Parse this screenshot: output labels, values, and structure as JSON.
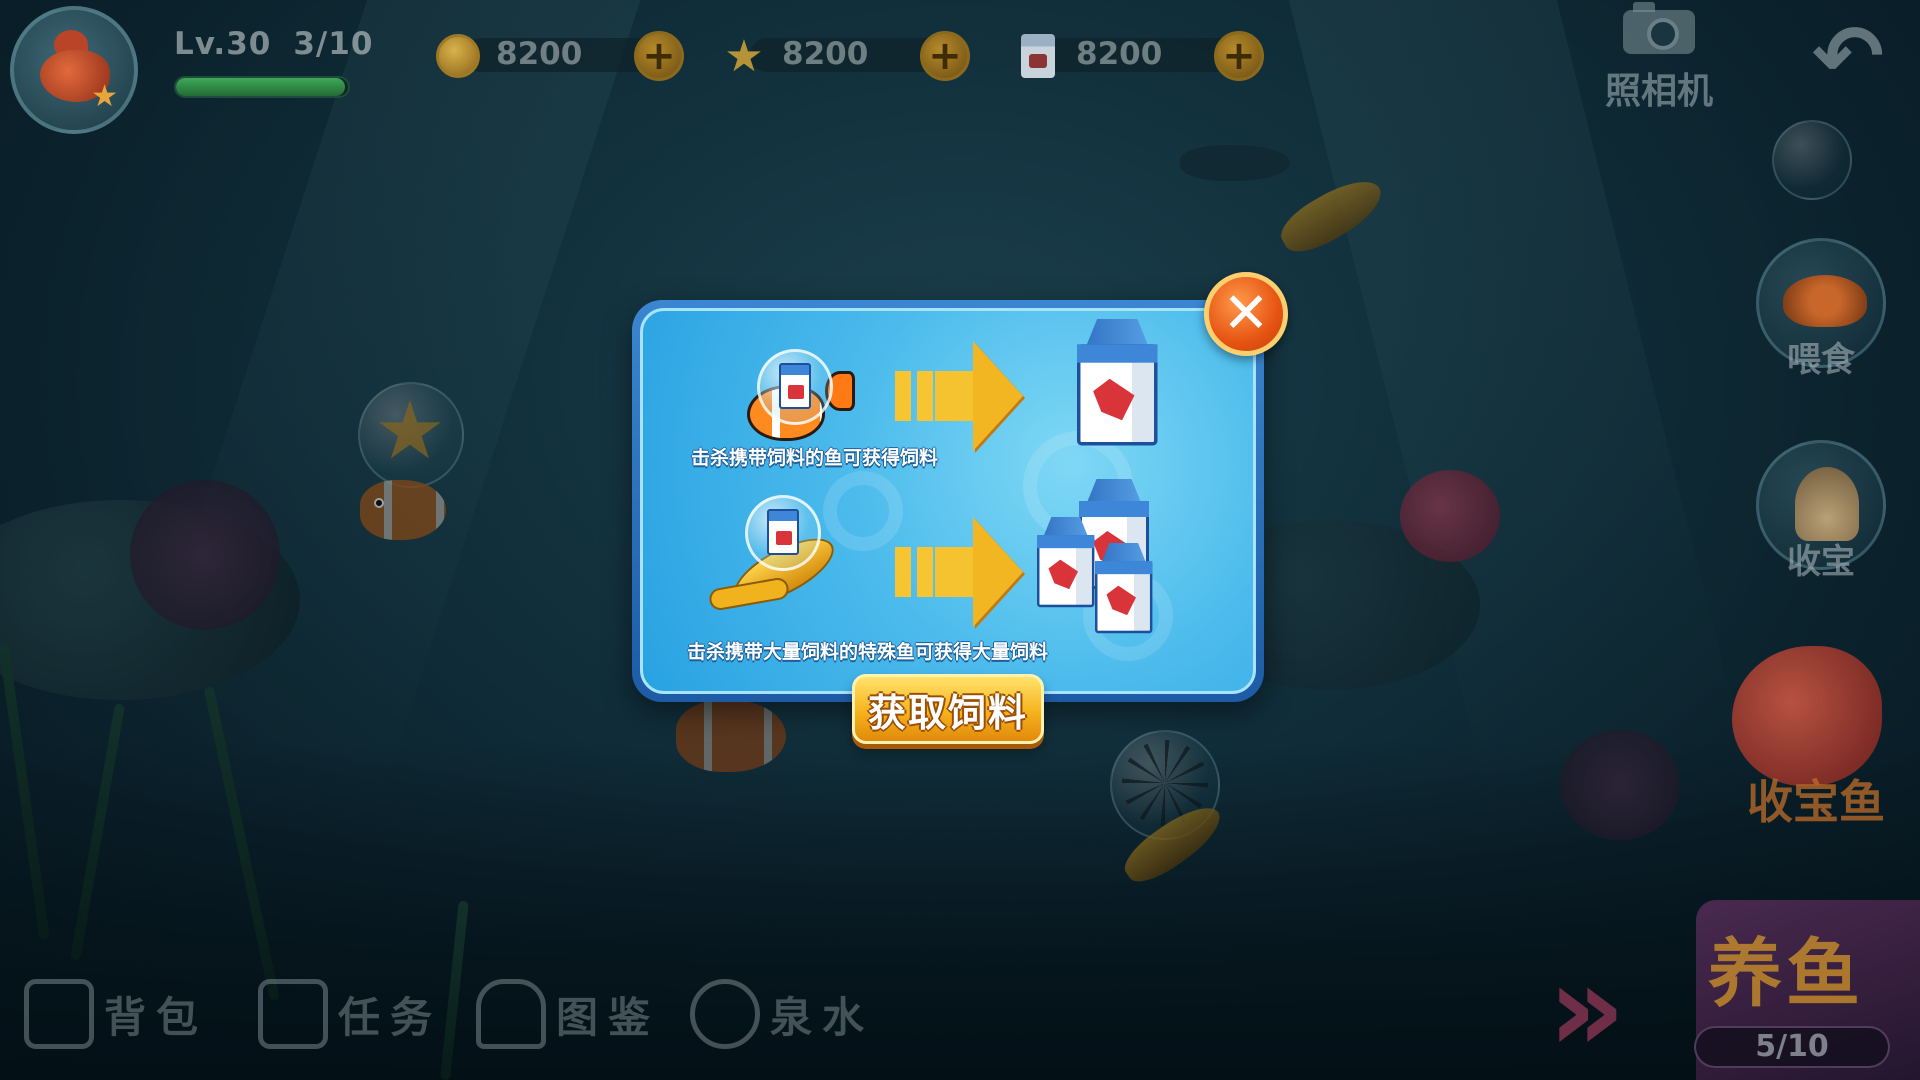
{
  "player": {
    "level_label": "Lv.30",
    "progress_text": "3/10",
    "xp_fraction": 0.98
  },
  "currencies": [
    {
      "icon": "coin-icon",
      "value": "8200"
    },
    {
      "icon": "star-icon",
      "value": "8200"
    },
    {
      "icon": "milk-carton-icon",
      "value": "8200"
    }
  ],
  "topright": {
    "camera_label": "照相机",
    "back_icon": "back-arrow-icon"
  },
  "side_buttons": {
    "feed_label": "喂食",
    "collect_label": "收宝",
    "treasure_fish_label": "收宝鱼"
  },
  "raise_fish": {
    "title": "养鱼",
    "count": "5/10"
  },
  "bottom_nav": [
    {
      "icon": "backpack-icon",
      "label": "背包"
    },
    {
      "icon": "task-list-icon",
      "label": "任务"
    },
    {
      "icon": "book-icon",
      "label": "图鉴"
    },
    {
      "icon": "spiral-water-icon",
      "label": "泉水"
    }
  ],
  "modal": {
    "row1_caption": "击杀携带饲料的鱼可获得饲料",
    "row2_caption": "击杀携带大量饲料的特殊鱼可获得大量饲料",
    "action_label": "获取饲料",
    "close_icon": "close-x-icon"
  },
  "colors": {
    "modal_frame": "#2b74c4",
    "action_button": "#f7b21d",
    "close_button": "#e65413",
    "xp_bar": "#3ea858"
  }
}
